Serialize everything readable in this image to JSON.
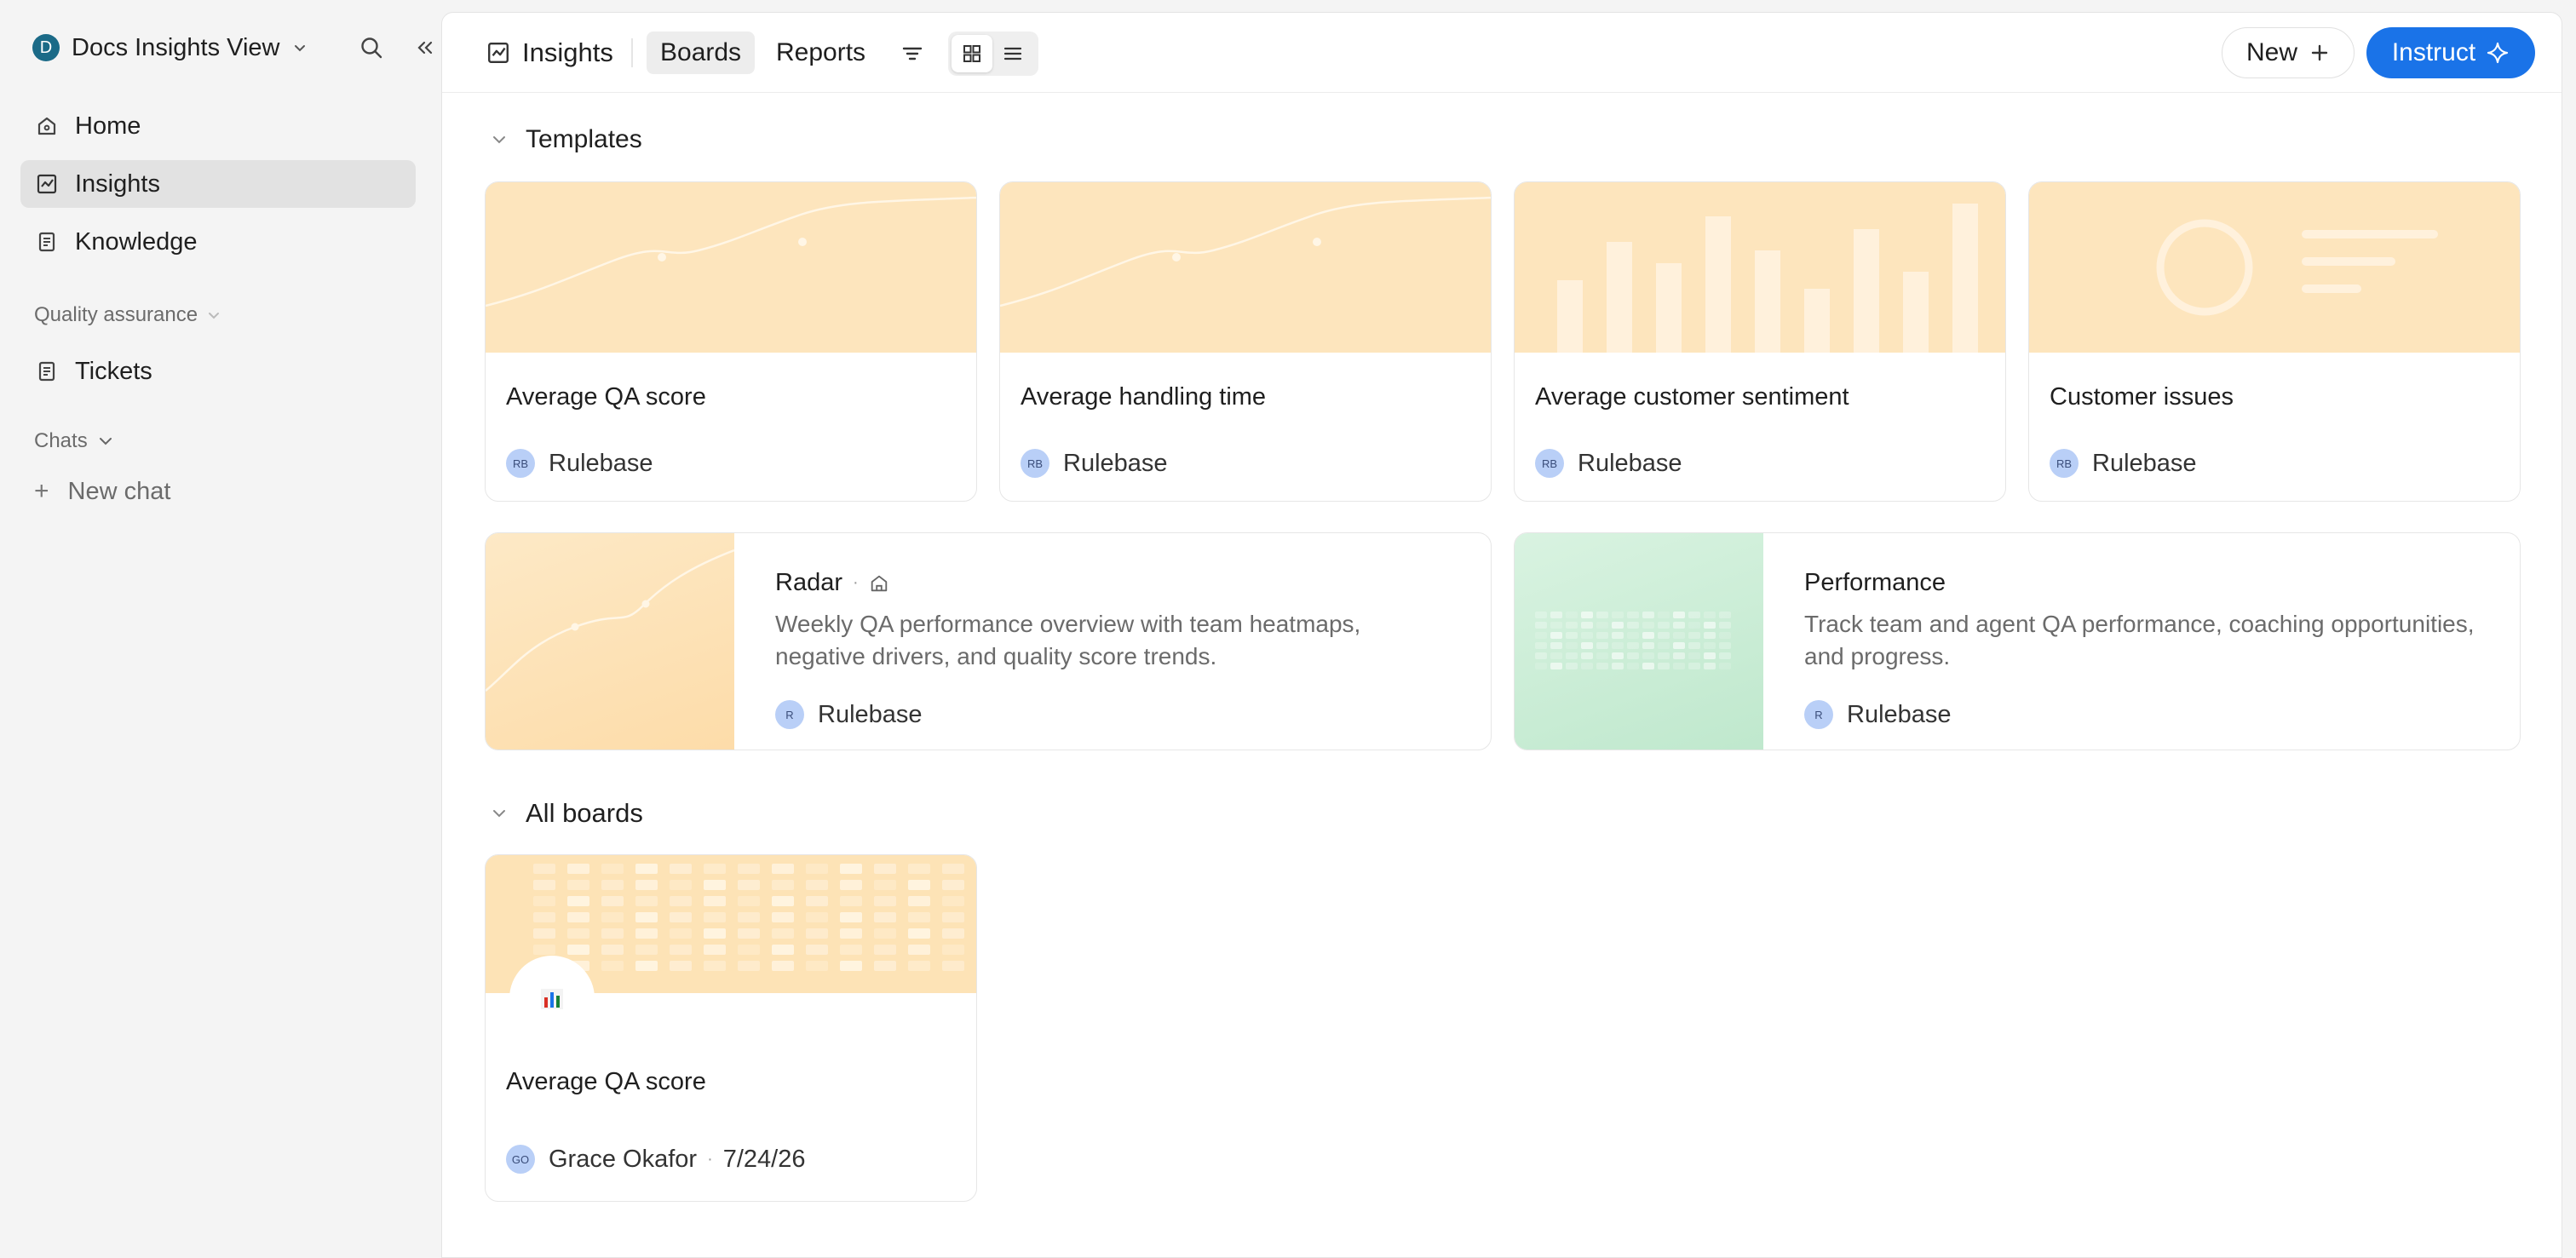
{
  "workspace": {
    "initial": "D",
    "name": "Docs Insights View"
  },
  "sidebar": {
    "items": [
      {
        "label": "Home"
      },
      {
        "label": "Insights"
      },
      {
        "label": "Knowledge"
      }
    ],
    "sections": [
      {
        "label": "Quality assurance",
        "items": [
          {
            "label": "Tickets"
          }
        ]
      },
      {
        "label": "Chats",
        "items": [
          {
            "label": "New chat"
          }
        ]
      }
    ]
  },
  "topbar": {
    "title": "Insights",
    "tabs": [
      {
        "label": "Boards"
      },
      {
        "label": "Reports"
      }
    ],
    "new_label": "New",
    "instruct_label": "Instruct"
  },
  "templates": {
    "heading": "Templates",
    "cards": [
      {
        "title": "Average QA score",
        "owner_initials": "RB",
        "owner": "Rulebase"
      },
      {
        "title": "Average handling time",
        "owner_initials": "RB",
        "owner": "Rulebase"
      },
      {
        "title": "Average customer sentiment",
        "owner_initials": "RB",
        "owner": "Rulebase"
      },
      {
        "title": "Customer issues",
        "owner_initials": "RB",
        "owner": "Rulebase"
      }
    ],
    "wide_cards": [
      {
        "title": "Radar",
        "description": "Weekly QA performance overview with team heatmaps, negative drivers, and quality score trends.",
        "owner_initials": "R",
        "owner": "Rulebase"
      },
      {
        "title": "Performance",
        "description": "Track team and agent QA performance, coaching opportunities, and progress.",
        "owner_initials": "R",
        "owner": "Rulebase"
      }
    ]
  },
  "boards": {
    "heading": "All boards",
    "cards": [
      {
        "title": "Average QA score",
        "owner_initials": "GO",
        "owner": "Grace Okafor",
        "date": "7/24/26"
      }
    ]
  },
  "colors": {
    "accent": "#1a73e8",
    "workspace_avatar": "#1b6a87",
    "template_thumb": "#fde5bd",
    "performance_thumb": "#c9ecd4"
  }
}
